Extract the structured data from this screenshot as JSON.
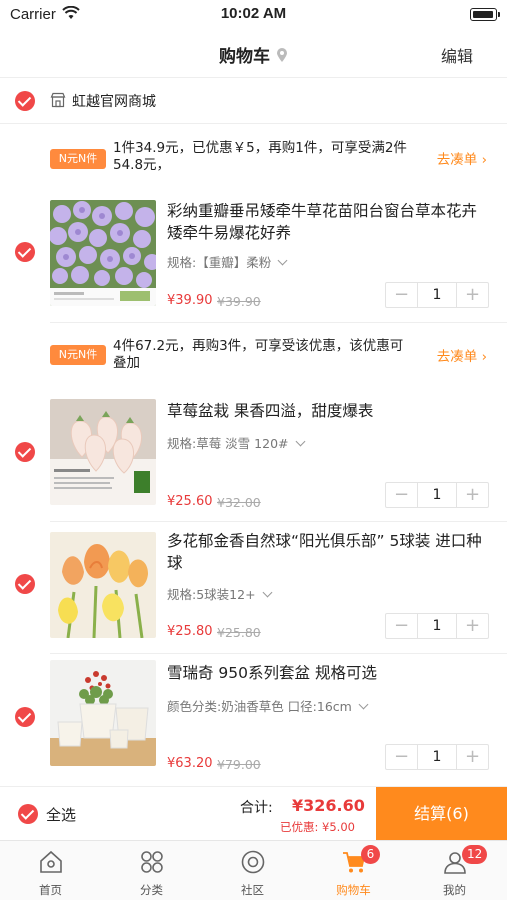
{
  "status_bar": {
    "carrier": "Carrier",
    "time": "10:02 AM"
  },
  "navbar": {
    "title": "购物车",
    "edit_label": "编辑"
  },
  "shop": {
    "name": "虹越官网商城"
  },
  "groups": [
    {
      "promo": {
        "tag": "N元N件",
        "text": "1件34.9元，已优惠￥5，再购1件，可享受满2件54.8元，",
        "action": "去凑单"
      },
      "items": [
        {
          "name": "彩纳重瓣垂吊矮牵牛草花苗阳台窗台草本花卉矮牵牛易爆花好养",
          "spec": "规格:【重瓣】柔粉",
          "price": "¥39.90",
          "original_price": "¥39.90",
          "qty": "1"
        }
      ]
    },
    {
      "promo": {
        "tag": "N元N件",
        "text": "4件67.2元，再购3件，可享受该优惠，该优惠可叠加",
        "action": "去凑单"
      },
      "items": [
        {
          "name": "草莓盆栽 果香四溢，甜度爆表",
          "spec": "规格:草莓 淡雪 120#",
          "price": "¥25.60",
          "original_price": "¥32.00",
          "qty": "1"
        },
        {
          "name": "多花郁金香自然球“阳光俱乐部” 5球装 进口种球",
          "spec": "规格:5球装12+",
          "price": "¥25.80",
          "original_price": "¥25.80",
          "qty": "1"
        }
      ]
    },
    {
      "items": [
        {
          "name": "雪瑞奇 950系列套盆 规格可选",
          "spec": "颜色分类:奶油香草色  口径:16cm",
          "price": "¥63.20",
          "original_price": "¥79.00",
          "qty": "1"
        }
      ]
    }
  ],
  "checkout": {
    "select_all": "全选",
    "total_label": "合计:",
    "total": "¥326.60",
    "saved": "已优惠: ¥5.00",
    "pay_label": "结算(6)"
  },
  "tabbar": [
    {
      "label": "首页",
      "icon": "home-icon"
    },
    {
      "label": "分类",
      "icon": "category-icon"
    },
    {
      "label": "社区",
      "icon": "community-icon"
    },
    {
      "label": "购物车",
      "icon": "cart-icon",
      "badge": "6",
      "active": true
    },
    {
      "label": "我的",
      "icon": "profile-icon",
      "badge": "12"
    }
  ],
  "colors": {
    "accent": "#ff8a1d",
    "price_red": "#e83a3a",
    "check_red": "#f04848"
  }
}
